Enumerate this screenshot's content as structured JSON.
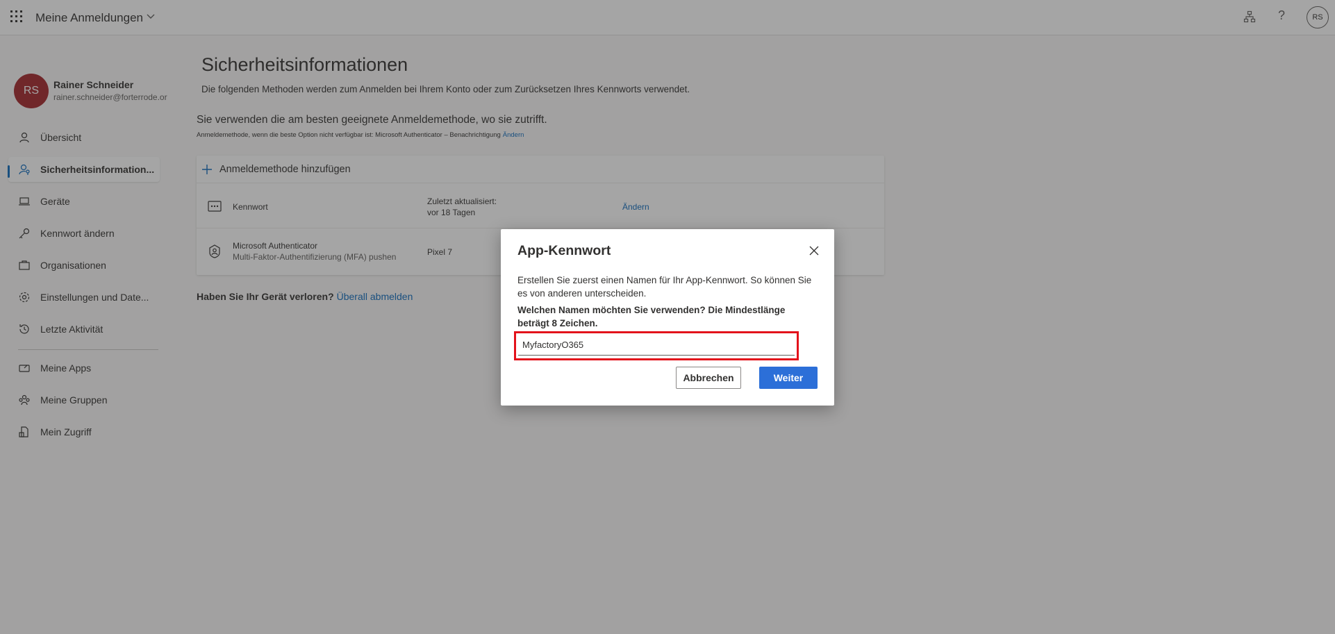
{
  "header": {
    "app_title": "Meine Anmeldungen",
    "avatar_initials": "RS",
    "help_glyph": "?",
    "icons": [
      "waffle-icon",
      "chevron-down-icon",
      "org-chart-icon",
      "help-icon"
    ]
  },
  "profile": {
    "initials": "RS",
    "name": "Rainer Schneider",
    "email": "rainer.schneider@forterrode.or",
    "avatar_color": "#a4262c"
  },
  "sidebar": {
    "items": [
      {
        "label": "Übersicht",
        "icon": "person-icon"
      },
      {
        "label": "Sicherheitsinformation...",
        "icon": "person-key-icon",
        "active": true
      },
      {
        "label": "Geräte",
        "icon": "laptop-icon"
      },
      {
        "label": "Kennwort ändern",
        "icon": "key-icon"
      },
      {
        "label": "Organisationen",
        "icon": "briefcase-icon"
      },
      {
        "label": "Einstellungen und Date...",
        "icon": "gear-icon"
      },
      {
        "label": "Letzte Aktivität",
        "icon": "history-icon"
      },
      {
        "label": "Meine Apps",
        "icon": "apps-icon"
      },
      {
        "label": "Meine Gruppen",
        "icon": "people-icon"
      },
      {
        "label": "Mein Zugriff",
        "icon": "lock-doc-icon"
      }
    ]
  },
  "main": {
    "title": "Sicherheitsinformationen",
    "subtitle": "Die folgenden Methoden werden zum Anmelden bei Ihrem Konto oder zum Zurücksetzen Ihres Kennworts verwendet.",
    "default_heading": "Sie verwenden die am besten geeignete Anmeldemethode, wo sie zutrifft.",
    "default_line": "Anmeldemethode, wenn die beste Option nicht verfügbar ist: Microsoft Authenticator – Benachrichtigung",
    "default_change": "Ändern",
    "add_method": "Anmeldemethode hinzufügen",
    "methods": [
      {
        "name": "Kennwort",
        "updated_label": "Zuletzt aktualisiert:",
        "updated_value": "vor 18 Tagen",
        "action": "Ändern",
        "icon": "password-dots-icon"
      },
      {
        "name": "Microsoft Authenticator",
        "detail": "Multi-Faktor-Authentifizierung (MFA) pushen",
        "device": "Pixel 7",
        "icon": "authenticator-icon"
      }
    ],
    "lost_device_question": "Haben Sie Ihr Gerät verloren?",
    "lost_device_link": "Überall abmelden"
  },
  "dialog": {
    "title": "App-Kennwort",
    "description": "Erstellen Sie zuerst einen Namen für Ihr App-Kennwort. So können Sie es von anderen unterscheiden.",
    "question": "Welchen Namen möchten Sie verwenden? Die Mindestlänge beträgt 8 Zeichen.",
    "input_value": "MyfactoryO365",
    "cancel_label": "Abbrechen",
    "next_label": "Weiter",
    "highlight_color": "#e3121b",
    "primary_color": "#2c6fd8"
  }
}
